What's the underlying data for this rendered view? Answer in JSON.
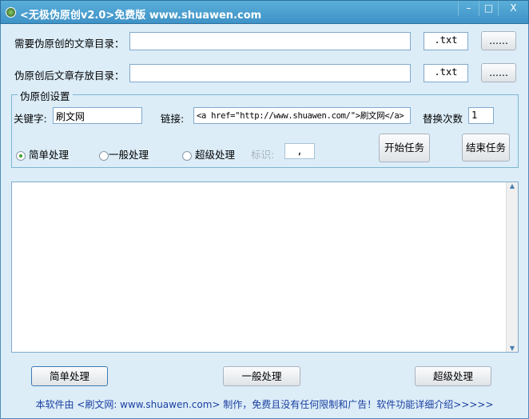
{
  "window": {
    "title": "<无极伪原创v2.0>免费版 www.shuawen.com",
    "minimize": "–",
    "maximize": "□",
    "close": "X"
  },
  "source": {
    "label": "需要伪原创的文章目录：",
    "value": "",
    "ext": ".txt",
    "browse": "......"
  },
  "target": {
    "label": "伪原创后文章存放目录：",
    "value": "",
    "ext": ".txt",
    "browse": "......"
  },
  "settings": {
    "title": "伪原创设置",
    "keyword_label": "关键字:",
    "keyword": "刷文网",
    "link_label": "链接:",
    "link": "<a href=\"http://www.shuawen.com/\">刷文网</a>",
    "count_label": "替换次数",
    "count": "1",
    "modes": [
      "简单处理",
      "一般处理",
      "超级处理"
    ],
    "selected_mode": 0,
    "marker_label": "标识:",
    "marker": ",",
    "start": "开始任务",
    "stop": "结束任务"
  },
  "log": {
    "text": ""
  },
  "bottom": {
    "simple": "简单处理",
    "normal": "一般处理",
    "super": "超级处理"
  },
  "footer": "本软件由 <刷文网: www.shuawen.com> 制作，免费且没有任何限制和广告！软件功能详细介绍>>>>>"
}
